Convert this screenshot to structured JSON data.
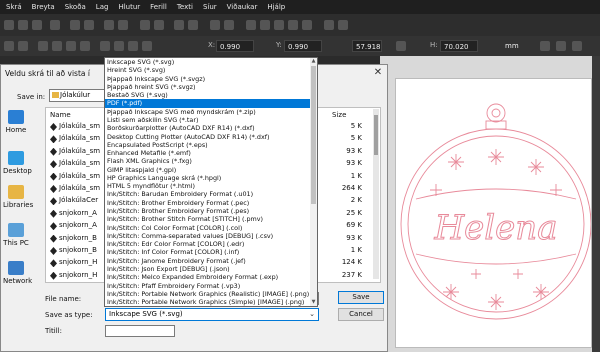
{
  "menubar": [
    "Skrá",
    "Breyta",
    "Skoða",
    "Lag",
    "Hlutur",
    "Ferill",
    "Texti",
    "Síur",
    "Viðaukar",
    "Hjálp"
  ],
  "toolbar": {
    "x_label": "X:",
    "x_value": "0.990",
    "y_label": "Y:",
    "y_value": "0.990",
    "w_value": "57.918",
    "h_label": "H:",
    "h_value": "70.020",
    "unit": "mm"
  },
  "dialog": {
    "title": "Veldu skrá til að vista í",
    "close": "✕",
    "save_in_label": "Save in:",
    "save_in_value": "Jólakúlur",
    "nav": [
      {
        "label": "Home",
        "icon": "home-icon",
        "color": "#2a7fd4"
      },
      {
        "label": "Desktop",
        "icon": "desktop-icon",
        "color": "#2e9be0"
      },
      {
        "label": "Libraries",
        "icon": "libraries-icon",
        "color": "#e7b544"
      },
      {
        "label": "This PC",
        "icon": "computer-icon",
        "color": "#5aa0d8"
      },
      {
        "label": "Network",
        "icon": "network-icon",
        "color": "#3a7ec8"
      }
    ],
    "columns": {
      "name": "Name",
      "size": "Size"
    },
    "files": [
      {
        "name": "Jólakúla_sm",
        "size": "5 K"
      },
      {
        "name": "Jólakúla_sm",
        "size": "5 K"
      },
      {
        "name": "Jólakúla_sm",
        "size": "93 K"
      },
      {
        "name": "Jólakúla_sm",
        "size": "93 K"
      },
      {
        "name": "Jólakúla_sm",
        "size": "1 K"
      },
      {
        "name": "Jólakúla_sm",
        "size": "264 K"
      },
      {
        "name": "JólakúlaCer",
        "size": "2 K"
      },
      {
        "name": "snjokorn_A",
        "size": "25 K"
      },
      {
        "name": "snjokorn_A",
        "size": "69 K"
      },
      {
        "name": "snjokorn_B",
        "size": "93 K"
      },
      {
        "name": "snjokorn_B",
        "size": "1 K"
      },
      {
        "name": "snjokorn_H",
        "size": "124 K"
      },
      {
        "name": "snjokorn_H",
        "size": "237 K"
      }
    ],
    "file_name_label": "File name:",
    "save_as_type_label": "Save as type:",
    "save_as_type_value": "Inkscape SVG (*.svg)",
    "title_label": "Titill:",
    "save_button": "Save",
    "cancel_button": "Cancel"
  },
  "dropdown": {
    "selected_index": 5,
    "options": [
      "Inkscape SVG (*.svg)",
      "Hreint SVG (*.svg)",
      "Þjappað Inkscape SVG (*.svgz)",
      "Þjappað hreint SVG (*.svgz)",
      "Bestað SVG (*.svg)",
      "PDF (*.pdf)",
      "Þjappað Inkscape SVG með myndskrám (*.zip)",
      "Listi sem aðskilin SVG (*.tar)",
      "Borðskurðarplotter (AutoCAD DXF R14) (*.dxf)",
      "Desktop Cutting Plotter (AutoCAD DXF R14) (*.dxf)",
      "Encapsulated PostScript (*.eps)",
      "Enhanced Metafile (*.emf)",
      "Flash XML Graphics (*.fxg)",
      "GIMP litaspjald (*.gpl)",
      "HP Graphics Language skrá (*.hpgl)",
      "HTML 5 myndflötur (*.html)",
      "Ink/Stitch: Barudan Embroidery Format (.u01)",
      "Ink/Stitch: Brother Embroidery Format (.pec)",
      "Ink/Stitch: Brother Embroidery Format (.pes)",
      "Ink/Stitch: Brother Stitch Format [STITCH] (.pmv)",
      "Ink/Stitch: Col Color Format [COLOR] (.col)",
      "Ink/Stitch: Comma-separated values [DEBUG] (.csv)",
      "Ink/Stitch: Edr Color Format [COLOR] (.edr)",
      "Ink/Stitch: Inf Color Format [COLOR] (.inf)",
      "Ink/Stitch: Janome Embroidery Format (.jef)",
      "Ink/Stitch: Json Export [DEBUG] (.json)",
      "Ink/Stitch: Melco Expanded Embroidery Format (.exp)",
      "Ink/Stitch: Pfaff Embroidery Format (.vp3)",
      "Ink/Stitch: Portable Network Graphics (Realistic) [IMAGE] (.png)",
      "Ink/Stitch: Portable Network Graphics (Simple) [IMAGE] (.png)"
    ]
  },
  "canvas": {
    "ornament_text": "Helena",
    "accent": "#e88a9a"
  }
}
